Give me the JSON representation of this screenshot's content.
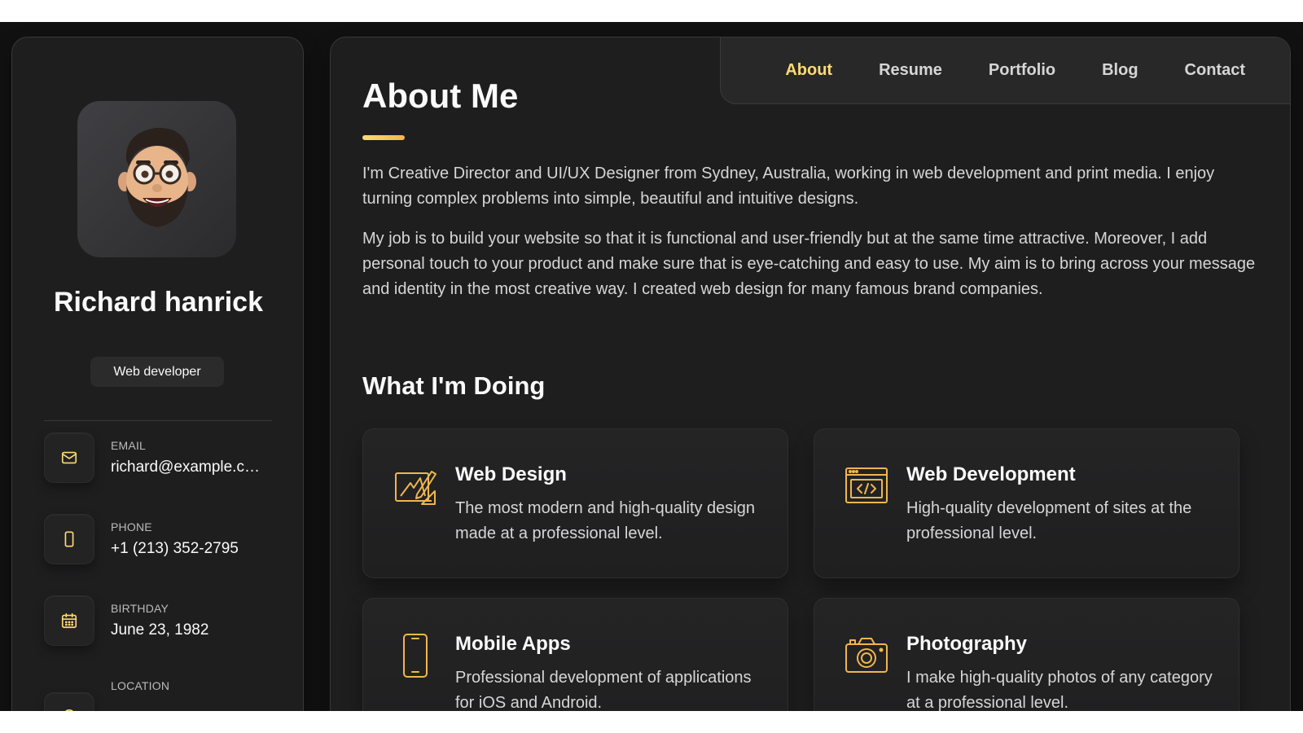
{
  "sidebar": {
    "name": "Richard hanrick",
    "title": "Web developer",
    "avatar_icon": "memoji-avatar",
    "contacts": [
      {
        "label": "EMAIL",
        "value": "richard@example.com",
        "icon": "mail-icon"
      },
      {
        "label": "PHONE",
        "value": "+1 (213) 352-2795",
        "icon": "phone-icon"
      },
      {
        "label": "BIRTHDAY",
        "value": "June 23, 1982",
        "icon": "calendar-icon"
      },
      {
        "label": "LOCATION",
        "value": "",
        "icon": "location-icon"
      }
    ]
  },
  "navbar": {
    "items": [
      {
        "label": "About",
        "active": true
      },
      {
        "label": "Resume",
        "active": false
      },
      {
        "label": "Portfolio",
        "active": false
      },
      {
        "label": "Blog",
        "active": false
      },
      {
        "label": "Contact",
        "active": false
      }
    ]
  },
  "about": {
    "title": "About Me",
    "paragraphs": [
      "I'm Creative Director and UI/UX Designer from Sydney, Australia, working in web development and print media. I enjoy turning complex problems into simple, beautiful and intuitive designs.",
      "My job is to build your website so that it is functional and user-friendly but at the same time attractive. Moreover, I add personal touch to your product and make sure that is eye-catching and easy to use. My aim is to bring across your message and identity in the most creative way. I created web design for many famous brand companies."
    ]
  },
  "services": {
    "title": "What I'm Doing",
    "items": [
      {
        "title": "Web Design",
        "text": "The most modern and high-quality design made at a professional level.",
        "icon": "design-icon"
      },
      {
        "title": "Web Development",
        "text": "High-quality development of sites at the professional level.",
        "icon": "code-icon"
      },
      {
        "title": "Mobile Apps",
        "text": "Professional development of applications for iOS and Android.",
        "icon": "mobile-icon"
      },
      {
        "title": "Photography",
        "text": "I make high-quality photos of any category at a professional level.",
        "icon": "camera-icon"
      }
    ]
  },
  "colors": {
    "accent": "#ffdb70",
    "background": "#111111",
    "card": "#1e1e1f",
    "text": "#d6d6d6"
  }
}
